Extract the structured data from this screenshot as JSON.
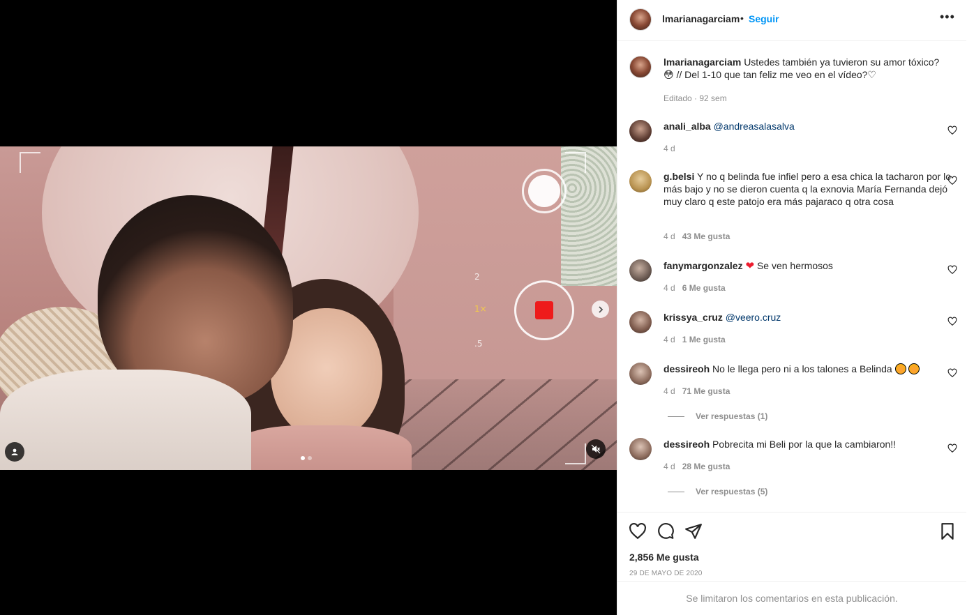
{
  "header": {
    "username": "lmarianagarciam",
    "separator": "•",
    "follow_label": "Seguir",
    "more_label": "•••"
  },
  "caption": {
    "username": "lmarianagarciam",
    "text": "Ustedes también ya tuvieron su amor tóxico? 😳 // Del 1-10 que tan feliz me veo en el vídeo?♡",
    "meta": "Editado · 92 sem"
  },
  "media": {
    "zoom_levels": [
      "2",
      "1×",
      ".5"
    ],
    "carousel_index": 1,
    "carousel_count": 2
  },
  "comments": [
    {
      "username": "anali_alba",
      "text": "@andreasalasalva",
      "time": "4 d",
      "likes": ""
    },
    {
      "username": "g.belsi",
      "text": "Y no q belinda fue infiel pero a esa chica la tacharon por lo más bajo y no se dieron cuenta q la exnovia María Fernanda dejó muy claro q este patojo era más pajaraco q otra cosa",
      "time": "4 d",
      "likes": "43 Me gusta"
    },
    {
      "username": "fanymargonzalez",
      "text": "Se ven hermosos",
      "time": "4 d",
      "likes": "6 Me gusta"
    },
    {
      "username": "krissya_cruz",
      "text": "@veero.cruz",
      "time": "4 d",
      "likes": "1 Me gusta"
    },
    {
      "username": "dessireoh",
      "text": "No le llega pero ni a los talones a Belinda",
      "time": "4 d",
      "likes": "71 Me gusta",
      "replies": "Ver respuestas (1)"
    },
    {
      "username": "dessireoh",
      "text": "Pobrecita mi Beli por la que la cambiaron!!",
      "time": "4 d",
      "likes": "28 Me gusta",
      "replies": "Ver respuestas (5)"
    }
  ],
  "stats": {
    "likes": "2,856 Me gusta",
    "date": "29 DE MAYO DE 2020"
  },
  "footer": {
    "notice": "Se limitaron los comentarios en esta publicación."
  },
  "icons": {
    "like": "heart-icon",
    "comment": "comment-icon",
    "share": "paper-plane-icon",
    "save": "bookmark-icon"
  },
  "colors": {
    "accent": "#0095f6",
    "mention": "#00376b",
    "secondary_text": "#8e8e8e",
    "record": "#ee1b1b"
  }
}
